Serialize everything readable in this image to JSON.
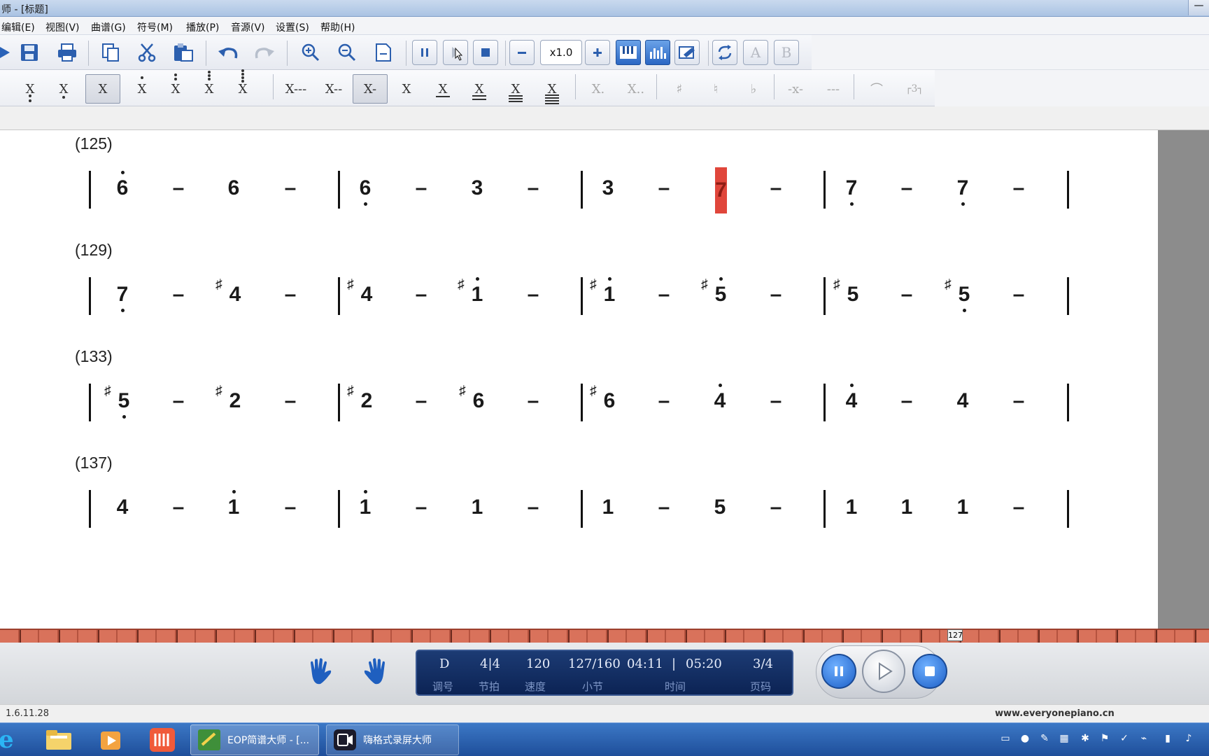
{
  "window": {
    "title": "师 - [标题]"
  },
  "menu": [
    "编辑(E)",
    "视图(V)",
    "曲谱(G)",
    "符号(M)",
    "播放(P)",
    "音源(V)",
    "设置(S)",
    "帮助(H)"
  ],
  "toolbar": {
    "zoom": "x1.0"
  },
  "note_buttons": [
    "X",
    "X",
    "X",
    "X",
    "X",
    "X",
    "X",
    "X---",
    "X--",
    "X-",
    "X",
    "X",
    "X",
    "X",
    "X",
    "X.",
    "X..",
    "♯",
    "♮",
    "♭",
    "-x-",
    "---",
    "⌒",
    "┌3┐"
  ],
  "score": {
    "systems": [
      {
        "label": "(125)",
        "measures": [
          [
            "6",
            "–",
            "6",
            "–"
          ],
          [
            "6",
            "–",
            "3",
            "–"
          ],
          [
            "3",
            "–",
            "7",
            "–"
          ],
          [
            "7",
            "–",
            "7",
            "–"
          ]
        ]
      },
      {
        "label": "(129)",
        "measures": [
          [
            "7",
            "–",
            "4",
            "–"
          ],
          [
            "4",
            "–",
            "1",
            "–"
          ],
          [
            "1",
            "–",
            "5",
            "–"
          ],
          [
            "5",
            "–",
            "5",
            "–"
          ]
        ]
      },
      {
        "label": "(133)",
        "measures": [
          [
            "5",
            "–",
            "2",
            "–"
          ],
          [
            "2",
            "–",
            "6",
            "–"
          ],
          [
            "6",
            "–",
            "4",
            "–"
          ],
          [
            "4",
            "–",
            "4",
            "–"
          ]
        ]
      },
      {
        "label": "(137)",
        "measures": [
          [
            "4",
            "–",
            "1",
            "–"
          ],
          [
            "1",
            "–",
            "1",
            "–"
          ],
          [
            "1",
            "–",
            "5",
            "–"
          ],
          [
            "1",
            "1",
            "1",
            "–"
          ]
        ]
      }
    ]
  },
  "timeline": {
    "marker": "127",
    "progress": 0.79
  },
  "player": {
    "key": "D",
    "time_sig": "4|4",
    "tempo": "120",
    "measure": "127/160",
    "time": "04:11",
    "total": "05:20",
    "page": "3/4",
    "labels": {
      "key": "调号",
      "beat": "节拍",
      "tempo": "速度",
      "measure": "小节",
      "time": "时间",
      "page": "页码"
    }
  },
  "status": {
    "version": "1.6.11.28",
    "website": "www.everyonepiano.cn"
  },
  "taskbar": {
    "tasks": [
      "EOP简谱大师 - [...",
      "嗨格式录屏大师"
    ]
  }
}
